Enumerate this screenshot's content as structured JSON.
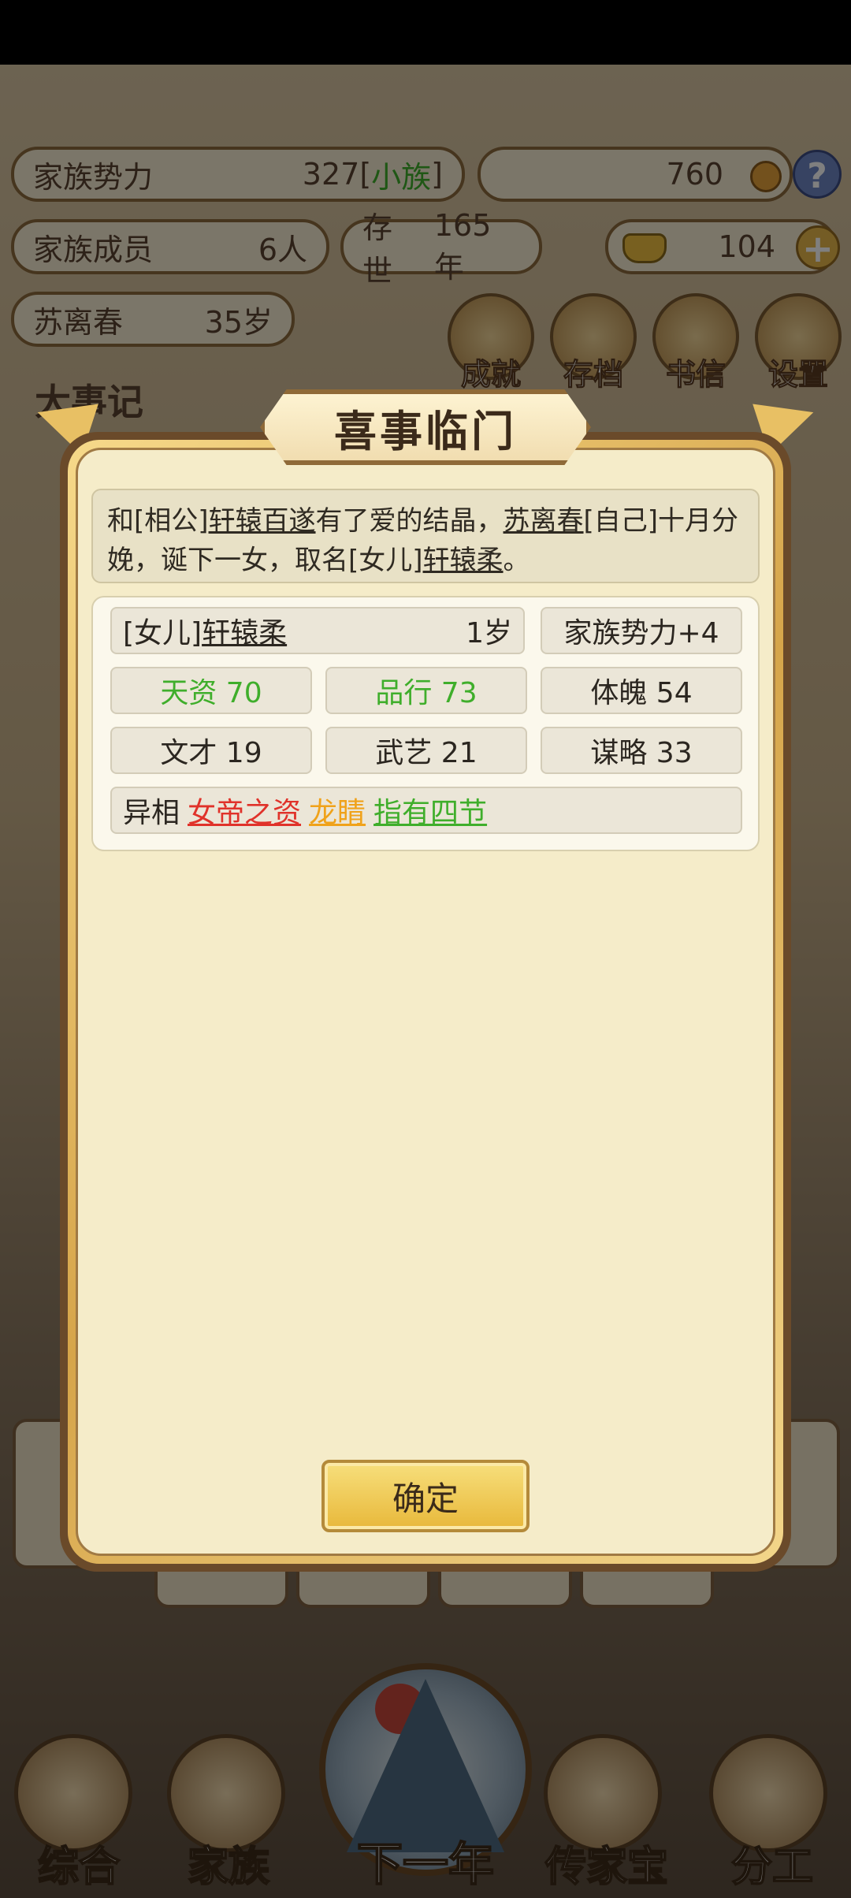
{
  "hud": {
    "family_power_label": "家族势力",
    "family_power_value": "327",
    "family_power_rank": "小族",
    "coins": "760",
    "family_members_label": "家族成员",
    "family_members_value": "6人",
    "existence_label": "存世",
    "existence_value": "165年",
    "gold": "104",
    "character_name": "苏离春",
    "character_age": "35岁",
    "round_buttons": [
      "成就",
      "存档",
      "书信",
      "设置"
    ],
    "section_title": "大事记"
  },
  "bottom_nav": {
    "items": [
      "综合",
      "家族",
      "下一年",
      "传家宝",
      "分工"
    ]
  },
  "modal": {
    "title": "喜事临门",
    "message": {
      "p1": "和[相公]",
      "spouse": "轩辕百遂",
      "p2": "有了爱的结晶，",
      "self_name": "苏离春",
      "p3": "[自己]十月分娩，诞下一女，取名[女儿]",
      "child": "轩辕柔",
      "p4": "。"
    },
    "child_card": {
      "relation": "[女儿]",
      "name": "轩辕柔",
      "age": "1岁",
      "power_bonus": "家族势力+4",
      "stats": [
        {
          "label": "天资 70",
          "color": "#3fae2b"
        },
        {
          "label": "品行 73",
          "color": "#3fae2b"
        },
        {
          "label": "体魄 54",
          "color": "#2b2620"
        },
        {
          "label": "文才 19",
          "color": "#2b2620"
        },
        {
          "label": "武艺 21",
          "color": "#2b2620"
        },
        {
          "label": "谋略 33",
          "color": "#2b2620"
        }
      ],
      "traits_label": "异相",
      "traits": [
        {
          "name": "女帝之资",
          "color": "#e0322a"
        },
        {
          "name": "龙睛",
          "color": "#f0a21a"
        },
        {
          "name": "指有四节",
          "color": "#3fae2b"
        }
      ]
    },
    "confirm_label": "确定"
  }
}
